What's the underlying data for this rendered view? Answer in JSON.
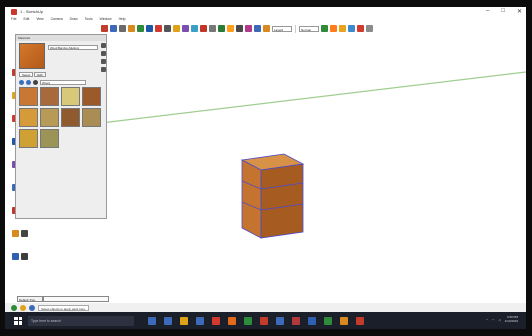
{
  "window": {
    "title": "1 - SketchUp",
    "min": "–",
    "max": "□",
    "close": "✕"
  },
  "menu": [
    "File",
    "Edit",
    "View",
    "Camera",
    "Draw",
    "Tools",
    "Window",
    "Help"
  ],
  "toolbar": {
    "icon_colors": [
      "#c33b2b",
      "#3d6ab8",
      "#6a6a6a",
      "#d98a1f",
      "#2f8a3a",
      "#1c5aa8",
      "#d33a2f",
      "#555555",
      "#e0a318",
      "#7a4fb0",
      "#3aa0c8",
      "#c2352b",
      "#777777",
      "#2c7b35",
      "#ff9f1c",
      "#4a4a4a",
      "#b33a8a",
      "#3d6ab8",
      "#d98a1f"
    ],
    "layer_value": "Layer0",
    "right_icon_colors": [
      "#2f8a3a",
      "#ff7b1c",
      "#e9a21e",
      "#3f89d0",
      "#d33a2f",
      "#8b8b8b"
    ],
    "right_input": "Normal"
  },
  "materials_panel": {
    "header": "Materials",
    "material_name": "Wood Bamboo Medium",
    "tabs": [
      "Select",
      "Edit"
    ],
    "library": "Wood",
    "swatches": [
      "#c87834",
      "#a86a3c",
      "#d8c87a",
      "#9c5a2a",
      "#d59a3a",
      "#b89a58",
      "#8e5a2e",
      "#a98d55",
      "#cfa033",
      "#9c9457"
    ],
    "side_icons": [
      "house-icon",
      "pencil-icon",
      "arrow-icon",
      "gear-icon"
    ]
  },
  "bottom_tab": "Default Tray",
  "status": {
    "text": "Select objects to apply paint here."
  },
  "taskbar": {
    "search_placeholder": "Type here to search",
    "app_colors": [
      "#3d6ab8",
      "#3d6ab8",
      "#e0a318",
      "#3d6ab8",
      "#d33a2f",
      "#e06a1a",
      "#2c8c3a",
      "#c33b2b",
      "#3d6ab8",
      "#b33a3a",
      "#2f5fb0",
      "#2f8a3a",
      "#d98a1f",
      "#c33b2b"
    ],
    "time": "4:50 PM",
    "date": "1/10/2019"
  },
  "colors": {
    "guide_line": "#9fce8e",
    "cube_front": "#c4742e",
    "cube_side": "#a65b21",
    "cube_top": "#d79248",
    "cube_edge": "#4a4ad0"
  }
}
